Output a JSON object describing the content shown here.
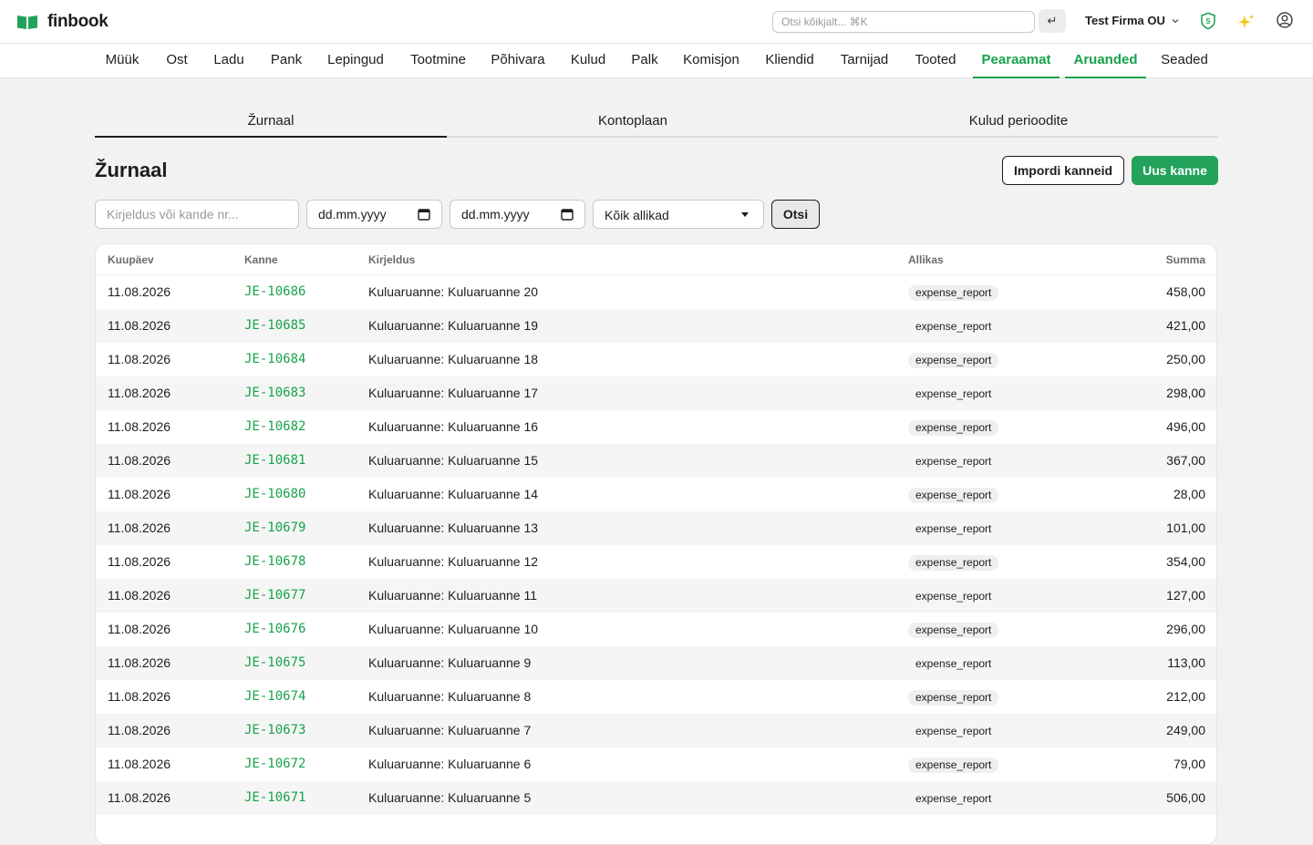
{
  "app": {
    "name": "finbook"
  },
  "topbar": {
    "search_placeholder": "Otsi kõikjalt...  ⌘K",
    "enter_glyph": "↵",
    "company": "Test Firma OU"
  },
  "nav": {
    "items": [
      {
        "label": "Müük",
        "active": false
      },
      {
        "label": "Ost",
        "active": false
      },
      {
        "label": "Ladu",
        "active": false
      },
      {
        "label": "Pank",
        "active": false
      },
      {
        "label": "Lepingud",
        "active": false
      },
      {
        "label": "Tootmine",
        "active": false
      },
      {
        "label": "Põhivara",
        "active": false
      },
      {
        "label": "Kulud",
        "active": false
      },
      {
        "label": "Palk",
        "active": false
      },
      {
        "label": "Komisjon",
        "active": false
      },
      {
        "label": "Kliendid",
        "active": false
      },
      {
        "label": "Tarnijad",
        "active": false
      },
      {
        "label": "Tooted",
        "active": false
      },
      {
        "label": "Pearaamat",
        "active": true
      },
      {
        "label": "Aruanded",
        "active": true
      },
      {
        "label": "Seaded",
        "active": false
      }
    ]
  },
  "subtabs": [
    {
      "label": "Žurnaal",
      "active": true
    },
    {
      "label": "Kontoplaan",
      "active": false
    },
    {
      "label": "Kulud perioodite",
      "active": false
    }
  ],
  "page": {
    "title": "Žurnaal",
    "import_button": "Impordi kanneid",
    "new_button": "Uus kanne"
  },
  "filters": {
    "description_placeholder": "Kirjeldus või kande nr...",
    "date_from": "dd.mm.yyyy",
    "date_to": "dd.mm.yyyy",
    "source_selected": "Kõik allikad",
    "search_button": "Otsi"
  },
  "table": {
    "columns": [
      "Kuupäev",
      "Kanne",
      "Kirjeldus",
      "Allikas",
      "Summa"
    ],
    "rows": [
      {
        "date": "11.08.2026",
        "entry": "JE-10686",
        "description": "Kuluaruanne: Kuluaruanne 20",
        "source": "expense_report",
        "amount": "458,00"
      },
      {
        "date": "11.08.2026",
        "entry": "JE-10685",
        "description": "Kuluaruanne: Kuluaruanne 19",
        "source": "expense_report",
        "amount": "421,00"
      },
      {
        "date": "11.08.2026",
        "entry": "JE-10684",
        "description": "Kuluaruanne: Kuluaruanne 18",
        "source": "expense_report",
        "amount": "250,00"
      },
      {
        "date": "11.08.2026",
        "entry": "JE-10683",
        "description": "Kuluaruanne: Kuluaruanne 17",
        "source": "expense_report",
        "amount": "298,00"
      },
      {
        "date": "11.08.2026",
        "entry": "JE-10682",
        "description": "Kuluaruanne: Kuluaruanne 16",
        "source": "expense_report",
        "amount": "496,00"
      },
      {
        "date": "11.08.2026",
        "entry": "JE-10681",
        "description": "Kuluaruanne: Kuluaruanne 15",
        "source": "expense_report",
        "amount": "367,00"
      },
      {
        "date": "11.08.2026",
        "entry": "JE-10680",
        "description": "Kuluaruanne: Kuluaruanne 14",
        "source": "expense_report",
        "amount": "28,00"
      },
      {
        "date": "11.08.2026",
        "entry": "JE-10679",
        "description": "Kuluaruanne: Kuluaruanne 13",
        "source": "expense_report",
        "amount": "101,00"
      },
      {
        "date": "11.08.2026",
        "entry": "JE-10678",
        "description": "Kuluaruanne: Kuluaruanne 12",
        "source": "expense_report",
        "amount": "354,00"
      },
      {
        "date": "11.08.2026",
        "entry": "JE-10677",
        "description": "Kuluaruanne: Kuluaruanne 11",
        "source": "expense_report",
        "amount": "127,00"
      },
      {
        "date": "11.08.2026",
        "entry": "JE-10676",
        "description": "Kuluaruanne: Kuluaruanne 10",
        "source": "expense_report",
        "amount": "296,00"
      },
      {
        "date": "11.08.2026",
        "entry": "JE-10675",
        "description": "Kuluaruanne: Kuluaruanne 9",
        "source": "expense_report",
        "amount": "113,00"
      },
      {
        "date": "11.08.2026",
        "entry": "JE-10674",
        "description": "Kuluaruanne: Kuluaruanne 8",
        "source": "expense_report",
        "amount": "212,00"
      },
      {
        "date": "11.08.2026",
        "entry": "JE-10673",
        "description": "Kuluaruanne: Kuluaruanne 7",
        "source": "expense_report",
        "amount": "249,00"
      },
      {
        "date": "11.08.2026",
        "entry": "JE-10672",
        "description": "Kuluaruanne: Kuluaruanne 6",
        "source": "expense_report",
        "amount": "79,00"
      },
      {
        "date": "11.08.2026",
        "entry": "JE-10671",
        "description": "Kuluaruanne: Kuluaruanne 5",
        "source": "expense_report",
        "amount": "506,00"
      }
    ]
  },
  "colors": {
    "accent": "#16a34a",
    "primary_button": "#22a25a"
  },
  "icons": [
    "book-logo-icon",
    "enter-icon",
    "chevron-down-icon",
    "shield-icon",
    "sparkles-icon",
    "user-icon",
    "calendar-icon",
    "caret-down-icon"
  ]
}
